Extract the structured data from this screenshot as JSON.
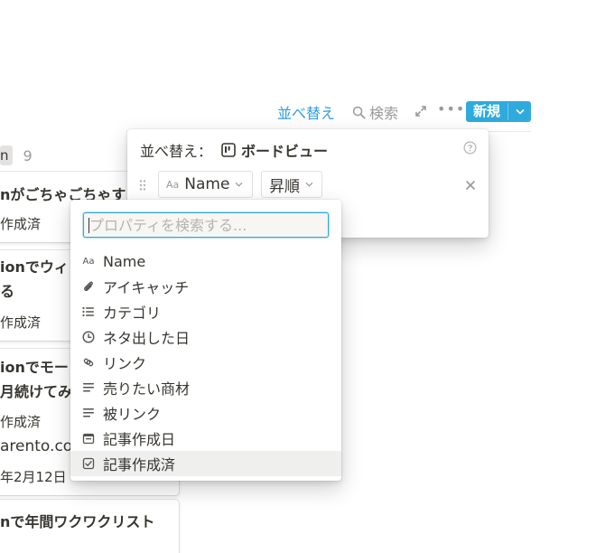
{
  "toolbar": {
    "sort_label": "並べ替え",
    "search_label": "検索",
    "more_label": "•••",
    "new_label": "新規"
  },
  "board": {
    "column_tag": "n",
    "column_count": "9",
    "cards": [
      {
        "title": "nがごちゃごちゃす",
        "status": "作成済"
      },
      {
        "title_line1": "ionでウィ",
        "title_line2": "る",
        "status": "作成済"
      },
      {
        "title_line1": "ionでモー",
        "title_line2": "月続けてみ",
        "status": "作成済",
        "link": "arento.co",
        "date": "年2月12日"
      },
      {
        "title": "nで年間ワクワクリスト"
      }
    ]
  },
  "sort_popover": {
    "title": "並べ替え：",
    "view_name": "ボードビュー",
    "property_type_glyph": "Aa",
    "property": "Name",
    "direction": "昇順"
  },
  "property_dropdown": {
    "search_placeholder": "プロパティを検索する...",
    "items": [
      {
        "label": "Name",
        "icon": "text-aa-icon"
      },
      {
        "label": "アイキャッチ",
        "icon": "paperclip-icon"
      },
      {
        "label": "カテゴリ",
        "icon": "list-icon"
      },
      {
        "label": "ネタ出した日",
        "icon": "clock-icon"
      },
      {
        "label": "リンク",
        "icon": "link-icon"
      },
      {
        "label": "売りたい商材",
        "icon": "text-lines-icon"
      },
      {
        "label": "被リンク",
        "icon": "text-lines-icon"
      },
      {
        "label": "記事作成日",
        "icon": "calendar-icon"
      },
      {
        "label": "記事作成済",
        "icon": "checkbox-icon"
      }
    ]
  },
  "colors": {
    "accent": "#2eaadc",
    "link_blue": "#2e9ce0",
    "text": "#37352f",
    "muted": "#9b9a97"
  }
}
